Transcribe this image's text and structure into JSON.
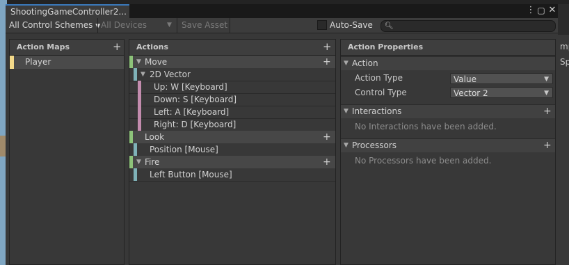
{
  "window": {
    "tab_title": "ShootingGameController2...",
    "more_icon": "vertical-dots",
    "maximize_icon": "maximize-square",
    "close_icon": "close-x"
  },
  "toolbar": {
    "control_schemes": "All Control Schemes",
    "devices": "All Devices",
    "save_asset": "Save Asset",
    "auto_save": "Auto-Save",
    "search_value": ""
  },
  "background_fragments": [
    "mp",
    "Sp"
  ],
  "action_maps": {
    "header": "Action Maps",
    "items": [
      {
        "label": "Player",
        "color": "#f3d98a",
        "selected": true
      }
    ]
  },
  "actions": {
    "header": "Actions",
    "rows": [
      {
        "label": "Move",
        "kind": "action",
        "color": "#8dc37a"
      },
      {
        "label": "2D Vector",
        "kind": "composite",
        "color": "#7fb2b8"
      },
      {
        "label": "Up: W [Keyboard]",
        "kind": "part",
        "color": "#c38cae"
      },
      {
        "label": "Down: S [Keyboard]",
        "kind": "part",
        "color": "#c38cae"
      },
      {
        "label": "Left: A [Keyboard]",
        "kind": "part",
        "color": "#c38cae"
      },
      {
        "label": "Right: D [Keyboard]",
        "kind": "part",
        "color": "#c38cae"
      },
      {
        "label": "Look",
        "kind": "action",
        "color": "#8dc37a"
      },
      {
        "label": "Position [Mouse]",
        "kind": "binding",
        "color": "#7fb2b8"
      },
      {
        "label": "Fire",
        "kind": "action",
        "color": "#8dc37a"
      },
      {
        "label": "Left Button [Mouse]",
        "kind": "binding",
        "color": "#7fb2b8"
      }
    ]
  },
  "properties": {
    "header": "Action Properties",
    "action_section": "Action",
    "action_type_label": "Action Type",
    "action_type_value": "Value",
    "control_type_label": "Control Type",
    "control_type_value": "Vector 2",
    "interactions_section": "Interactions",
    "interactions_empty": "No Interactions have been added.",
    "processors_section": "Processors",
    "processors_empty": "No Processors have been added."
  }
}
